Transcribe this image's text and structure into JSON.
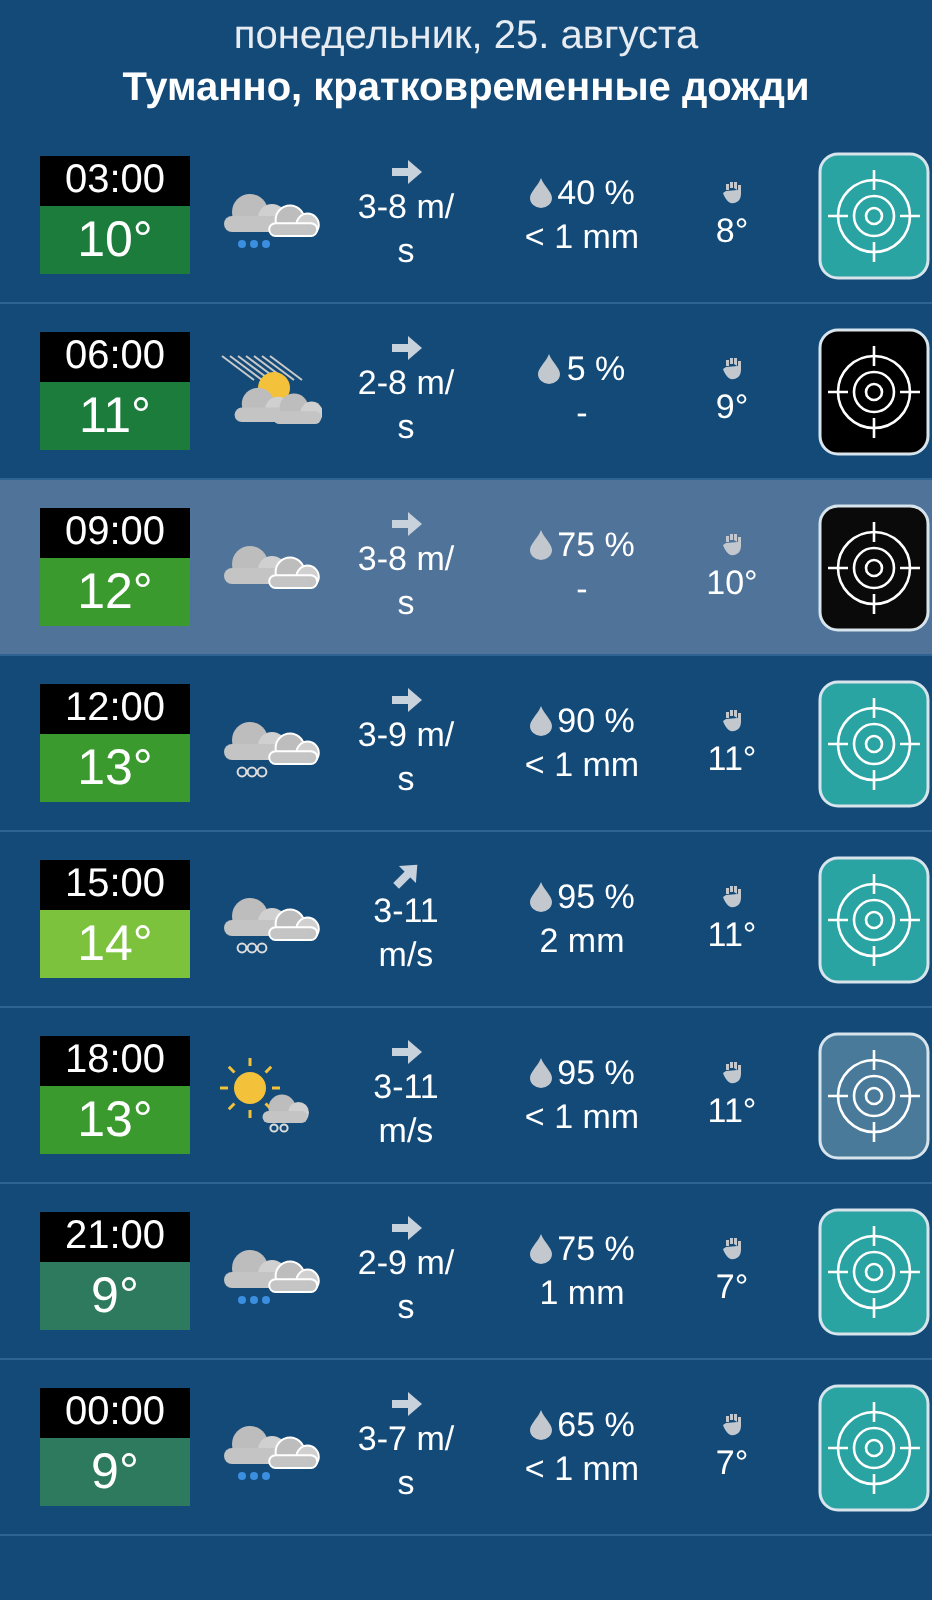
{
  "header": {
    "date": "понедельник, 25. августа",
    "summary": "Туманно, кратковременные дожди"
  },
  "rows": [
    {
      "time": "03:00",
      "temp": "10°",
      "color": "#1b7c3c",
      "kind": "rain",
      "wind": {
        "kind": "east",
        "speed": "3-8 m/ s"
      },
      "precip_chance": "40 %",
      "precip_amount": "< 1 mm",
      "feels": "8°",
      "radar": {
        "color": "#2aa3a3"
      },
      "selected": false
    },
    {
      "time": "06:00",
      "temp": "11°",
      "color": "#1b7c3c",
      "kind": "sunhaze",
      "wind": {
        "kind": "east",
        "speed": "2-8 m/ s"
      },
      "precip_chance": "5 %",
      "precip_amount": "-",
      "feels": "9°",
      "radar": {
        "color": "#000000"
      },
      "selected": false
    },
    {
      "time": "09:00",
      "temp": "12°",
      "color": "#3a9a2e",
      "kind": "cloud",
      "wind": {
        "kind": "east",
        "speed": "3-8 m/ s"
      },
      "precip_chance": "75 %",
      "precip_amount": "-",
      "feels": "10°",
      "radar": {
        "color": "#0a0a0a"
      },
      "selected": true
    },
    {
      "time": "12:00",
      "temp": "13°",
      "color": "#3a9a2e",
      "kind": "snow",
      "wind": {
        "kind": "east",
        "speed": "3-9 m/ s"
      },
      "precip_chance": "90 %",
      "precip_amount": "< 1 mm",
      "feels": "11°",
      "radar": {
        "color": "#2aa3a3"
      },
      "selected": false
    },
    {
      "time": "15:00",
      "temp": "14°",
      "color": "#7cc23c",
      "kind": "snow",
      "wind": {
        "kind": "northeast",
        "speed": "3-11 m/s"
      },
      "precip_chance": "95 %",
      "precip_amount": "2 mm",
      "feels": "11°",
      "radar": {
        "color": "#2aa3a3"
      },
      "selected": false
    },
    {
      "time": "18:00",
      "temp": "13°",
      "color": "#3a9a2e",
      "kind": "sunsnow",
      "wind": {
        "kind": "east",
        "speed": "3-11 m/s"
      },
      "precip_chance": "95 %",
      "precip_amount": "< 1 mm",
      "feels": "11°",
      "radar": {
        "color": "#4a7a9a"
      },
      "selected": false
    },
    {
      "time": "21:00",
      "temp": "9°",
      "color": "#2e7a5e",
      "kind": "rain",
      "wind": {
        "kind": "east",
        "speed": "2-9 m/ s"
      },
      "precip_chance": "75 %",
      "precip_amount": "1 mm",
      "feels": "7°",
      "radar": {
        "color": "#2aa3a3"
      },
      "selected": false
    },
    {
      "time": "00:00",
      "temp": "9°",
      "color": "#2e7a5e",
      "kind": "rain",
      "wind": {
        "kind": "east",
        "speed": "3-7 m/ s"
      },
      "precip_chance": "65 %",
      "precip_amount": "< 1 mm",
      "feels": "7°",
      "radar": {
        "color": "#2aa3a3"
      },
      "selected": false
    }
  ]
}
